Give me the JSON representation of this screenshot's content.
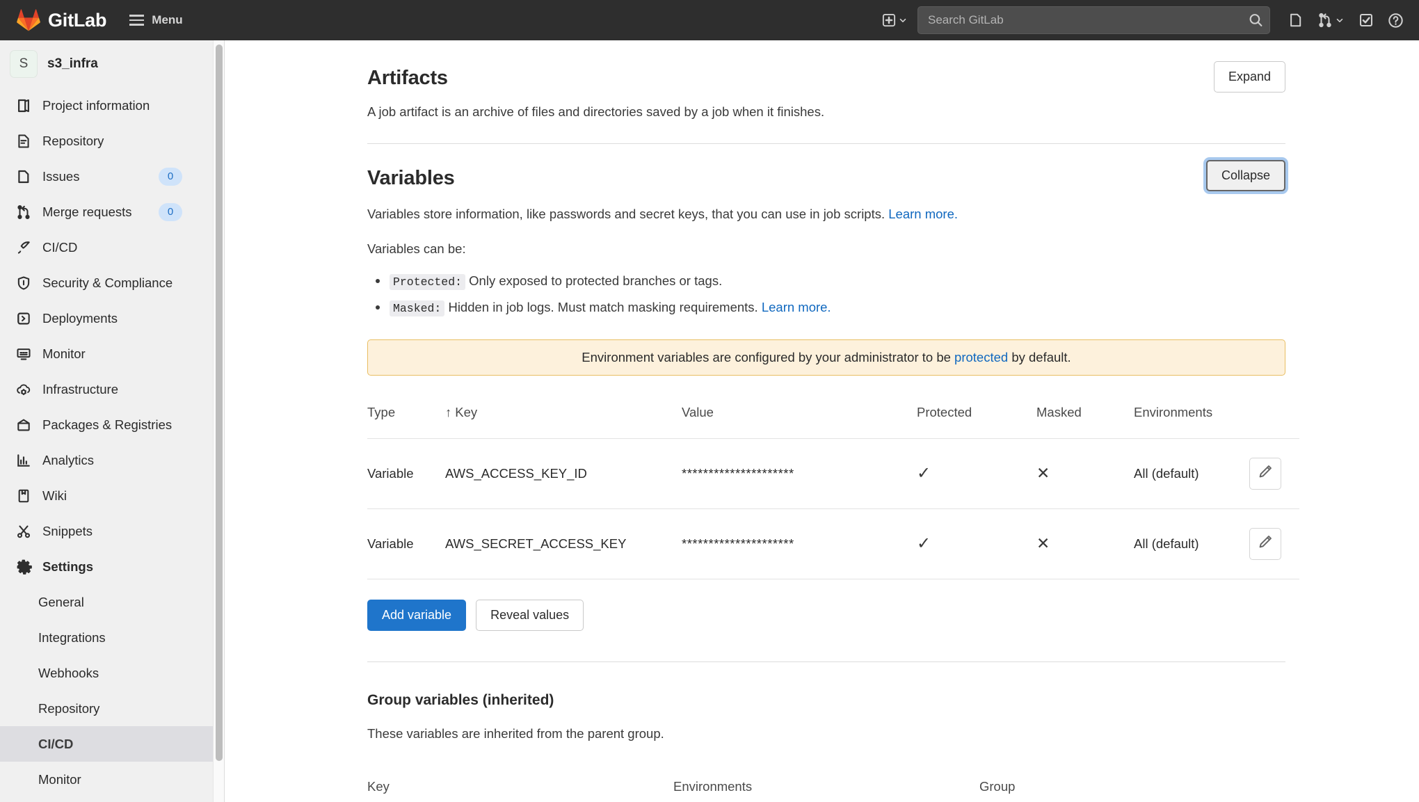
{
  "topbar": {
    "brand": "GitLab",
    "menu_label": "Menu",
    "plus_icon": "plus-square-icon",
    "plus_caret_icon": "chevron-down-icon",
    "search": {
      "placeholder": "Search GitLab",
      "value": "",
      "icon": "search-icon"
    },
    "icons": [
      {
        "name": "issues-icon",
        "label": "Issues"
      },
      {
        "name": "merge-requests-icon",
        "label": "Merge requests"
      },
      {
        "name": "chevron-down-icon",
        "label": "Merge requests menu"
      },
      {
        "name": "todos-icon",
        "label": "To-Do List"
      },
      {
        "name": "help-icon",
        "label": "Help"
      }
    ]
  },
  "sidebar": {
    "project": {
      "initial": "S",
      "name": "s3_infra"
    },
    "items": [
      {
        "label": "Project information",
        "icon": "project-information-icon",
        "badge": null
      },
      {
        "label": "Repository",
        "icon": "repository-icon",
        "badge": null
      },
      {
        "label": "Issues",
        "icon": "issues-icon",
        "badge": "0"
      },
      {
        "label": "Merge requests",
        "icon": "merge-requests-icon",
        "badge": "0"
      },
      {
        "label": "CI/CD",
        "icon": "ci-cd-icon",
        "badge": null
      },
      {
        "label": "Security & Compliance",
        "icon": "shield-icon",
        "badge": null
      },
      {
        "label": "Deployments",
        "icon": "deployments-icon",
        "badge": null
      },
      {
        "label": "Monitor",
        "icon": "monitor-icon",
        "badge": null
      },
      {
        "label": "Infrastructure",
        "icon": "infrastructure-cloud-icon",
        "badge": null
      },
      {
        "label": "Packages & Registries",
        "icon": "package-icon",
        "badge": null
      },
      {
        "label": "Analytics",
        "icon": "analytics-chart-icon",
        "badge": null
      },
      {
        "label": "Wiki",
        "icon": "wiki-book-icon",
        "badge": null
      },
      {
        "label": "Snippets",
        "icon": "snippets-scissors-icon",
        "badge": null
      },
      {
        "label": "Settings",
        "icon": "gear-icon",
        "badge": null
      }
    ],
    "settings_subitems": [
      {
        "label": "General",
        "active": false
      },
      {
        "label": "Integrations",
        "active": false
      },
      {
        "label": "Webhooks",
        "active": false
      },
      {
        "label": "Repository",
        "active": false
      },
      {
        "label": "CI/CD",
        "active": true
      },
      {
        "label": "Monitor",
        "active": false
      }
    ]
  },
  "main": {
    "artifacts": {
      "title": "Artifacts",
      "description": "A job artifact is an archive of files and directories saved by a job when it finishes.",
      "expand_label": "Expand"
    },
    "variables": {
      "title": "Variables",
      "collapse_label": "Collapse",
      "intro": "Variables store information, like passwords and secret keys, that you can use in job scripts.",
      "intro_link": "Learn more.",
      "can_be": "Variables can be:",
      "bullets": [
        {
          "term": "Protected:",
          "text": "Only exposed to protected branches or tags.",
          "link": ""
        },
        {
          "term": "Masked:",
          "text": "Hidden in job logs. Must match masking requirements.",
          "link": "Learn more."
        }
      ],
      "alert": {
        "prefix": "Environment variables are configured by your administrator to be",
        "link": "protected",
        "suffix": "by default."
      },
      "table": {
        "headers": [
          "Type",
          "Key",
          "Value",
          "Protected",
          "Masked",
          "Environments"
        ],
        "sort_indicator": "↑",
        "sorted_column": "Key",
        "rows": [
          {
            "type": "Variable",
            "key": "AWS_ACCESS_KEY_ID",
            "value": "*********************",
            "protected": "✓",
            "masked": "✕",
            "environments": "All (default)",
            "edit_icon": "pencil-edit-icon"
          },
          {
            "type": "Variable",
            "key": "AWS_SECRET_ACCESS_KEY",
            "value": "*********************",
            "protected": "✓",
            "masked": "✕",
            "environments": "All (default)",
            "edit_icon": "pencil-edit-icon"
          }
        ]
      },
      "add_variable_label": "Add variable",
      "reveal_values_label": "Reveal values"
    },
    "group_variables": {
      "title": "Group variables (inherited)",
      "description": "These variables are inherited from the parent group.",
      "headers": [
        "Key",
        "Environments",
        "Group"
      ]
    }
  },
  "colors": {
    "navbar_bg": "#2e2e2e",
    "sidebar_bg": "#f0f0f0",
    "primary_blue": "#1f75cb",
    "link_blue": "#1068bf",
    "alert_bg": "#fdf1dc",
    "alert_border": "#e9be62",
    "badge_bg": "#cfe3fa",
    "focus_ring": "#a8c9ee"
  }
}
